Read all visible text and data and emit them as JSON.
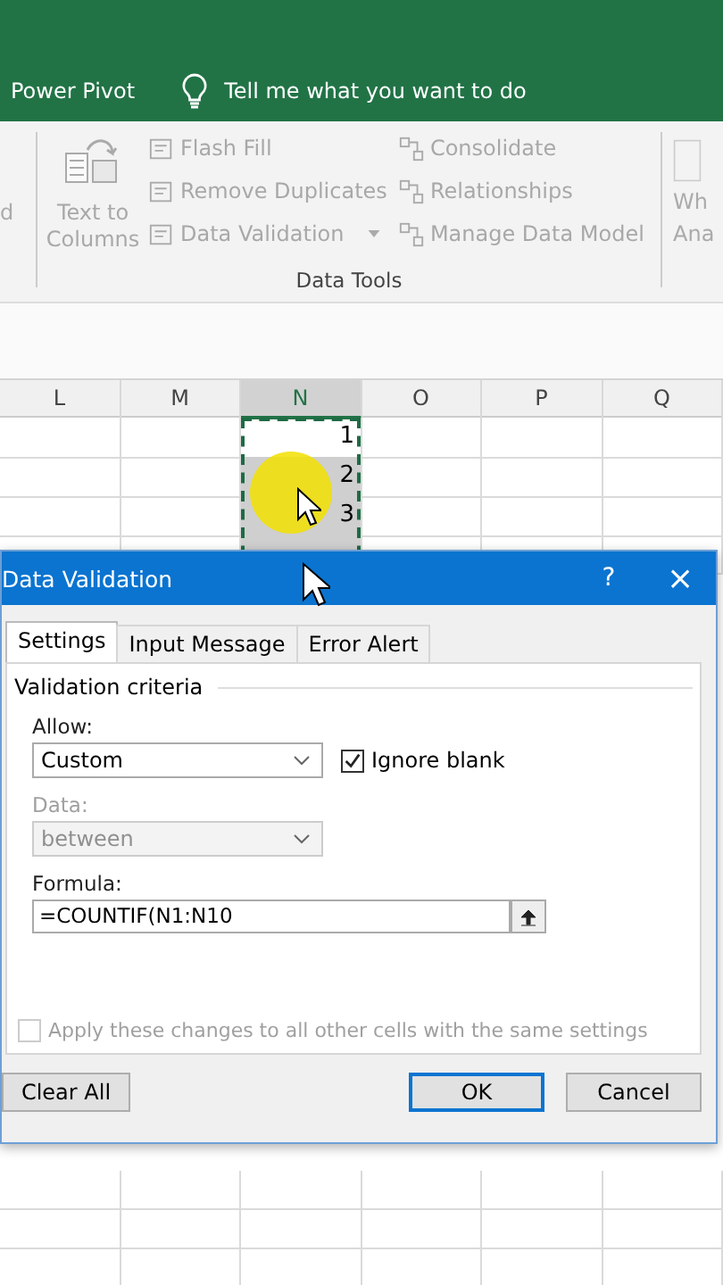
{
  "ribbon_tabs": {
    "items": [
      "Power Pivot"
    ],
    "tell_me": "Tell me what you want to do"
  },
  "ribbon": {
    "left_cut": "d",
    "big_button": {
      "label": "Text to Columns",
      "disabled": true
    },
    "column_1": [
      {
        "label": "Flash Fill",
        "disabled": true,
        "dropdown": false
      },
      {
        "label": "Remove Duplicates",
        "disabled": true,
        "dropdown": false
      },
      {
        "label": "Data Validation",
        "disabled": true,
        "dropdown": true
      }
    ],
    "column_2": [
      {
        "label": "Consolidate",
        "disabled": true
      },
      {
        "label": "Relationships",
        "disabled": true
      },
      {
        "label": "Manage Data Model",
        "disabled": true
      }
    ],
    "group_label": "Data Tools",
    "right_cut": [
      "Wh",
      "Ana"
    ]
  },
  "sheet": {
    "columns": [
      {
        "label": "L",
        "selected": false
      },
      {
        "label": "M",
        "selected": false
      },
      {
        "label": "N",
        "selected": true
      },
      {
        "label": "O",
        "selected": false
      },
      {
        "label": "P",
        "selected": false
      },
      {
        "label": "Q",
        "selected": false
      }
    ],
    "n_cells": [
      {
        "value": "1",
        "selected": false
      },
      {
        "value": "2",
        "selected": true
      },
      {
        "value": "3",
        "selected": true
      }
    ]
  },
  "dialog": {
    "title": "Data Validation",
    "help": "?",
    "close": "×",
    "tabs": [
      {
        "label": "Settings",
        "selected": true
      },
      {
        "label": "Input Message",
        "selected": false
      },
      {
        "label": "Error Alert",
        "selected": false
      }
    ],
    "group": "Validation criteria",
    "allow": {
      "label": "Allow:",
      "value": "Custom",
      "disabled": false
    },
    "ignore_blank": {
      "label": "Ignore blank",
      "checked": true
    },
    "data": {
      "label": "Data:",
      "value": "between",
      "disabled": true
    },
    "formula": {
      "label": "Formula:",
      "value": "=COUNTIF(N1:N10"
    },
    "apply_all": {
      "label": "Apply these changes to all other cells with the same settings",
      "checked": false,
      "disabled": true
    },
    "buttons": [
      {
        "label": "Clear All",
        "default": false
      },
      {
        "label": "OK",
        "default": true
      },
      {
        "label": "Cancel",
        "default": false
      }
    ]
  }
}
